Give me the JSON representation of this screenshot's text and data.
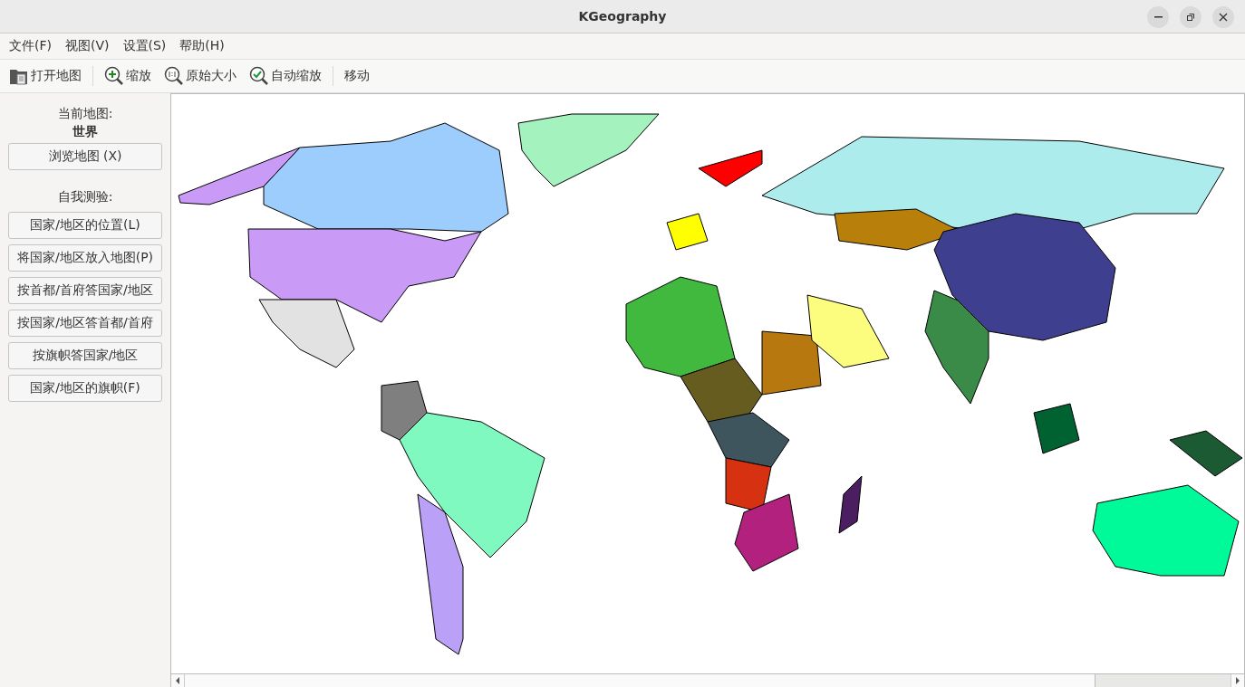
{
  "window": {
    "title": "KGeography"
  },
  "menu": [
    "文件(F)",
    "视图(V)",
    "设置(S)",
    "帮助(H)"
  ],
  "toolbar": [
    {
      "kind": "open",
      "label": "打开地图"
    },
    {
      "kind": "zoom",
      "label": "缩放"
    },
    {
      "kind": "original",
      "label": "原始大小"
    },
    {
      "kind": "auto",
      "label": "自动缩放"
    },
    {
      "kind": "move",
      "label": "移动"
    }
  ],
  "sidebar": {
    "current_label": "当前地图:",
    "current_map": "世界",
    "browse_button": "浏览地图 (X)",
    "quiz_label": "自我测验:",
    "quiz_buttons": [
      "国家/地区的位置(L)",
      "将国家/地区放入地图(P)",
      "按首都/首府答国家/地区",
      "按国家/地区答首都/首府",
      "按旗帜答国家/地区",
      "国家/地区的旗帜(F)"
    ]
  }
}
